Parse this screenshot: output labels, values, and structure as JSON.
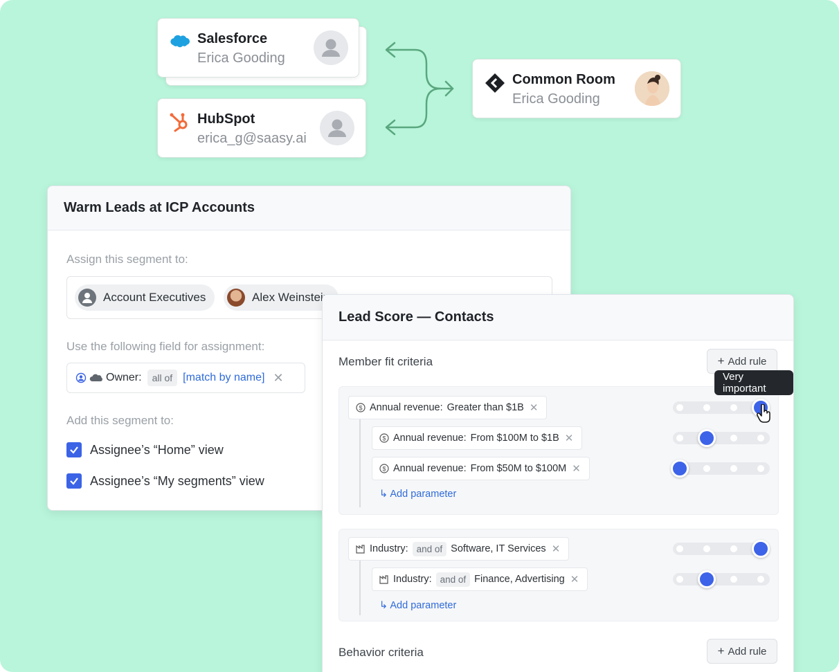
{
  "sync_cards": [
    {
      "source": "Salesforce",
      "identity": "Erica Gooding",
      "logo": "salesforce-logo",
      "avatar": "placeholder-avatar"
    },
    {
      "source": "HubSpot",
      "identity": "erica_g@saasy.ai",
      "logo": "hubspot-logo",
      "avatar": "placeholder-avatar"
    }
  ],
  "merged_card": {
    "source": "Common Room",
    "identity": "Erica Gooding",
    "logo": "common-room-logo",
    "avatar": "user-photo"
  },
  "segment_panel": {
    "title": "Warm Leads at ICP Accounts",
    "assign_label": "Assign this segment to:",
    "assignees": [
      "Account Executives",
      "Alex Weinstein"
    ],
    "field_label": "Use the following field for assignment:",
    "owner_field": {
      "label": "Owner:",
      "operator": "all of",
      "value": "[match by name]"
    },
    "add_label": "Add this segment to:",
    "views": [
      {
        "label": "Assignee’s “Home” view",
        "checked": true
      },
      {
        "label": "Assignee’s “My segments” view",
        "checked": true
      }
    ]
  },
  "lead_panel": {
    "title": "Lead Score — Contacts",
    "member_fit_title": "Member fit criteria",
    "behavior_title": "Behavior criteria",
    "add_rule_label": "Add rule",
    "add_parameter_label": "Add parameter",
    "tooltip": "Very important",
    "revenue_rules": [
      {
        "key": "Annual revenue:",
        "value": "Greater than $1B",
        "importance_level": 4
      },
      {
        "key": "Annual revenue:",
        "value": "From $100M to $1B",
        "importance_level": 2
      },
      {
        "key": "Annual revenue:",
        "value": "From $50M to $100M",
        "importance_level": 1
      }
    ],
    "industry_rules": [
      {
        "key": "Industry:",
        "operator": "and of",
        "value": "Software, IT Services",
        "importance_level": 4
      },
      {
        "key": "Industry:",
        "operator": "and of",
        "value": "Finance, Advertising",
        "importance_level": 2
      }
    ],
    "importance_scale_max": 4
  },
  "colors": {
    "background": "#b8f5da",
    "accent": "#3d63e8",
    "link": "#2f6bd8",
    "arrow": "#5aa77f"
  }
}
